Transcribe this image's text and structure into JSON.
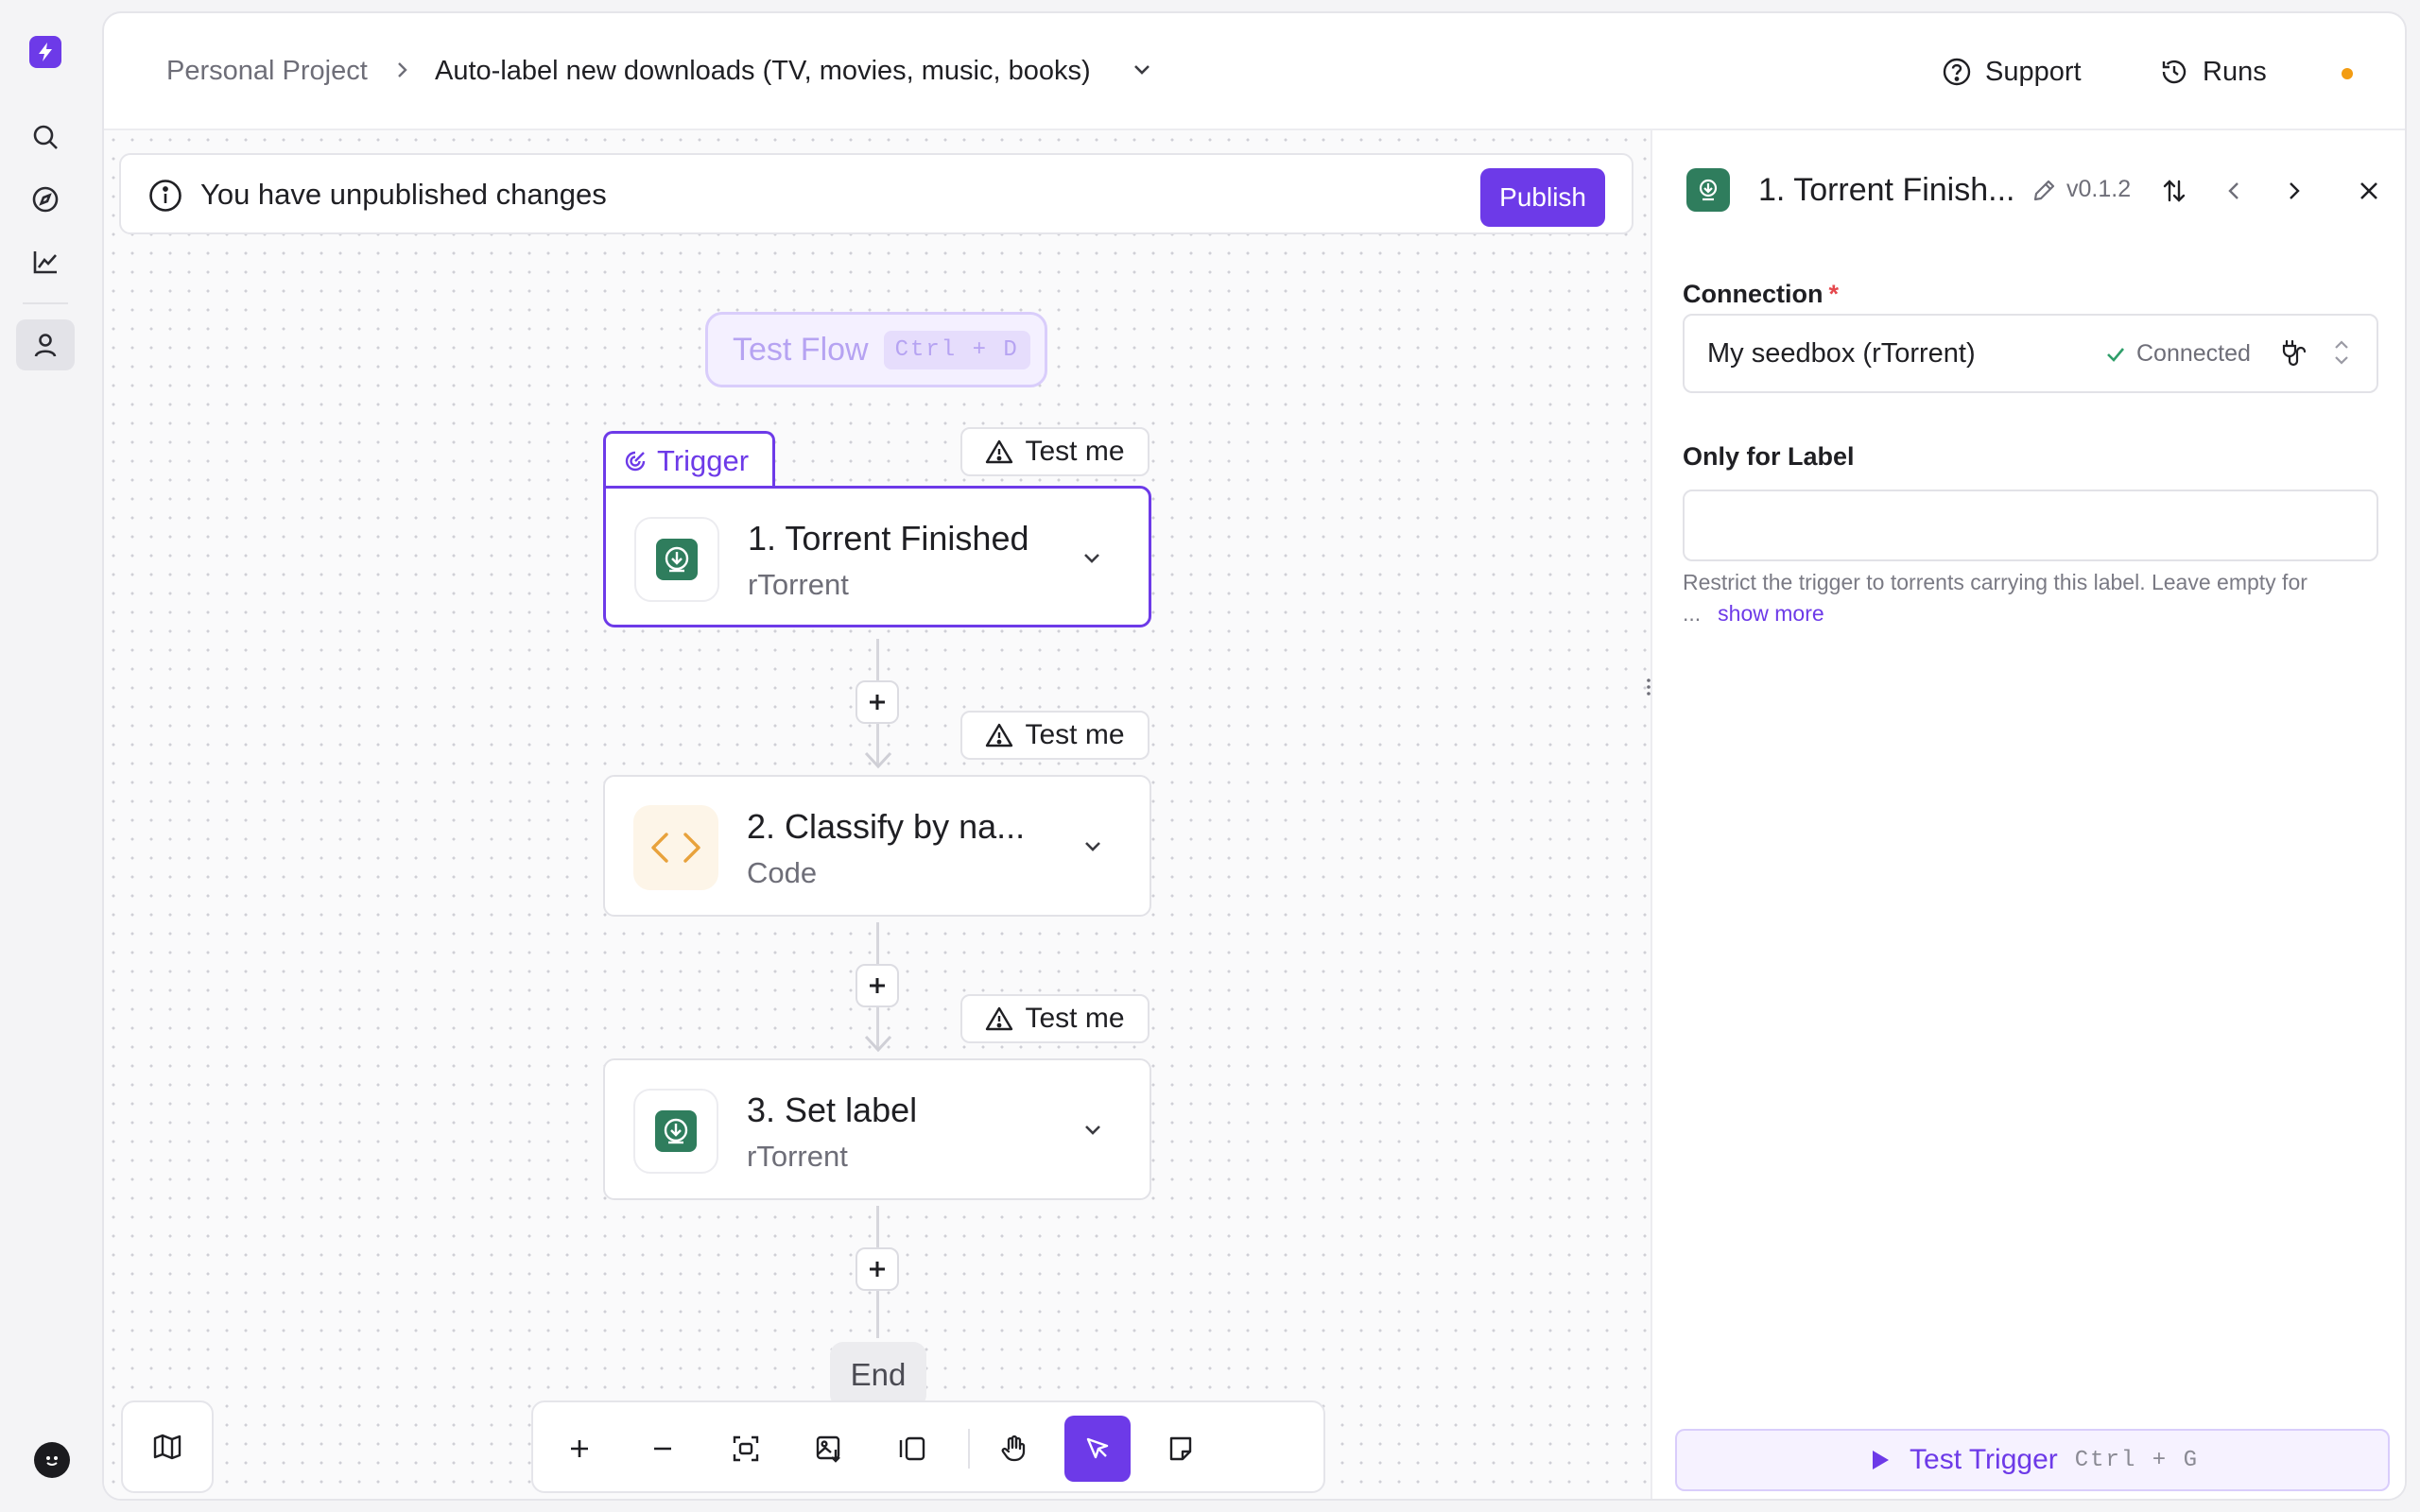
{
  "colors": {
    "accent": "#6d3ae8",
    "warning_dot": "#f39c12",
    "rtorrent_green": "#2f7d5d",
    "code_orange": "#e8a23c",
    "connected_green": "#2f9e6a",
    "required_red": "#e5484d"
  },
  "sidebar": {
    "icons": [
      "bolt-logo",
      "search-icon",
      "compass-icon",
      "chart-icon",
      "user-icon"
    ],
    "active": "user-icon"
  },
  "header": {
    "breadcrumb_root": "Personal Project",
    "flow_name": "Auto-label new downloads (TV, movies, music, books)",
    "support_label": "Support",
    "runs_label": "Runs"
  },
  "banner": {
    "message": "You have unpublished changes",
    "publish_label": "Publish"
  },
  "canvas": {
    "test_flow_label": "Test Flow",
    "test_flow_shortcut": "Ctrl + D",
    "trigger_tab_label": "Trigger",
    "test_me_label": "Test me",
    "end_label": "End",
    "steps": [
      {
        "title": "1. Torrent Finished",
        "subtitle": "rTorrent",
        "icon": "download-icon",
        "selected": true
      },
      {
        "title": "2. Classify by na...",
        "subtitle": "Code",
        "icon": "code-icon",
        "selected": false
      },
      {
        "title": "3. Set label",
        "subtitle": "rTorrent",
        "icon": "download-icon",
        "selected": false
      }
    ],
    "toolbar_tools": [
      "zoom-in",
      "zoom-out",
      "fit-view",
      "image-export",
      "panel-toggle",
      "hand-tool",
      "pointer-tool",
      "note-tool"
    ],
    "active_tool": "pointer-tool"
  },
  "panel": {
    "title": "1. Torrent Finish...",
    "version": "v0.1.2",
    "connection_label": "Connection",
    "connection_required_mark": "*",
    "connection_value": "My seedbox (rTorrent)",
    "connection_status": "Connected",
    "label_field_label": "Only for Label",
    "label_field_value": "",
    "help_text": "Restrict the trigger to torrents carrying this label. Leave empty for ...",
    "show_more": "show more",
    "test_trigger_label": "Test Trigger",
    "test_trigger_shortcut": "Ctrl + G"
  }
}
